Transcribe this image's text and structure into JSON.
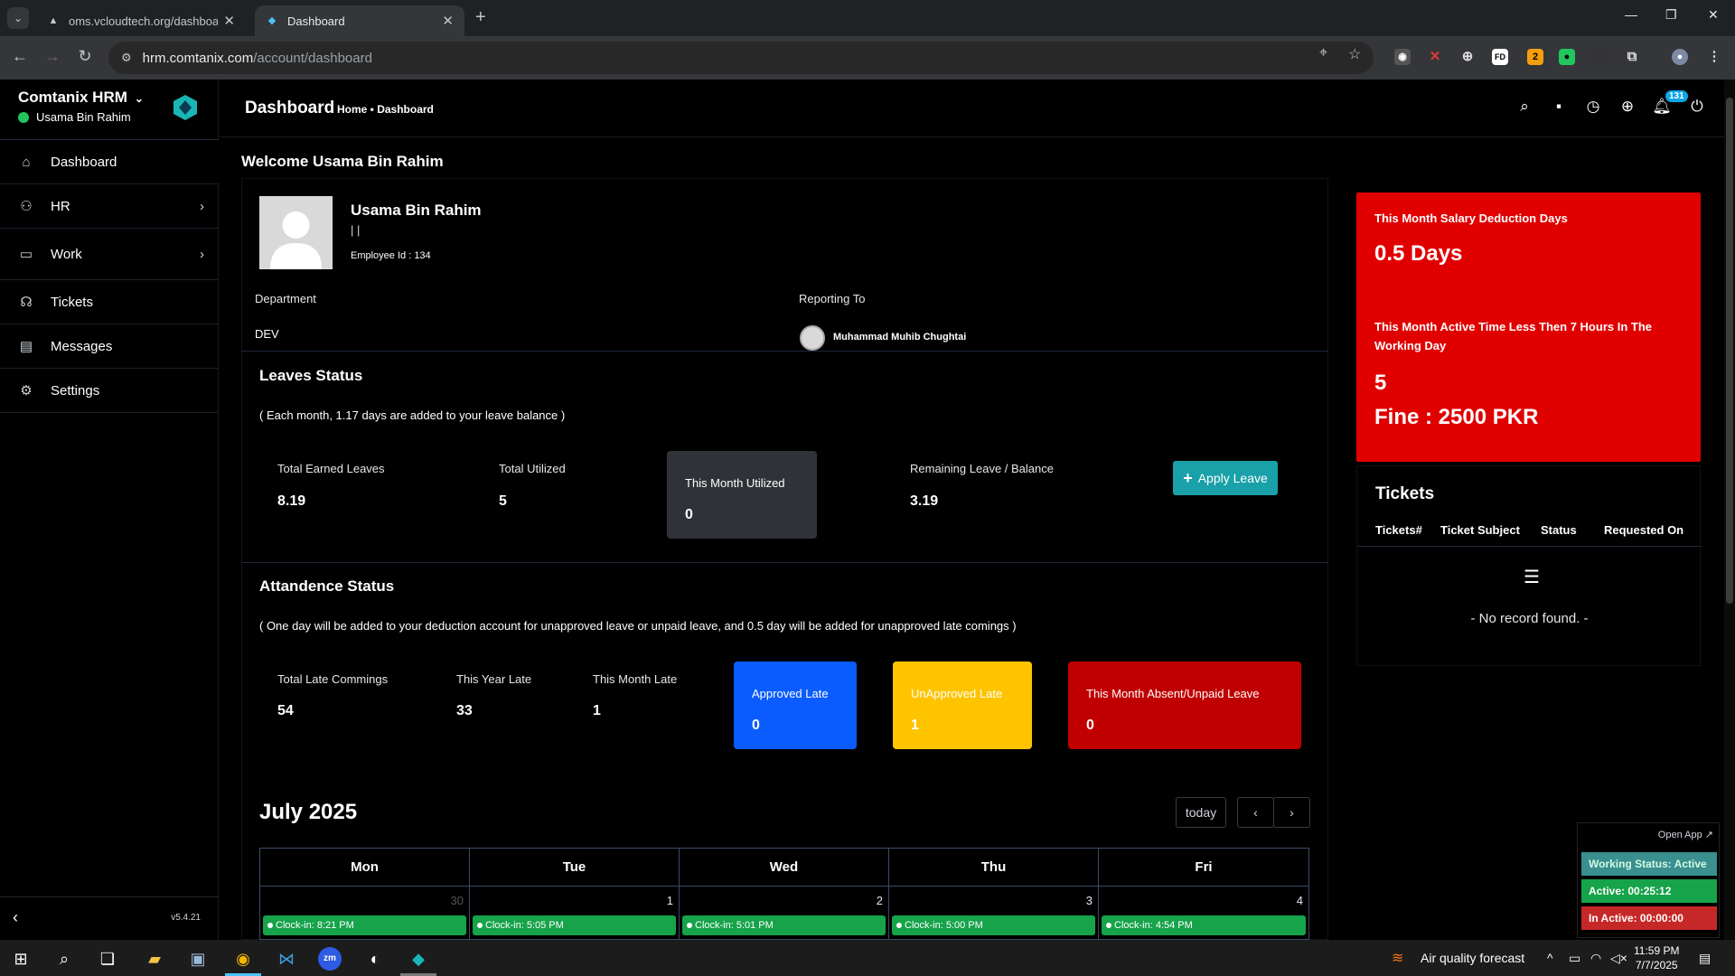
{
  "browser": {
    "tabs": [
      {
        "title": "oms.vcloudtech.org/dashboard",
        "active": false
      },
      {
        "title": "Dashboard",
        "active": true
      }
    ],
    "url_host": "hrm.comtanix.com",
    "url_path": "/account/dashboard"
  },
  "sidebar": {
    "brand": "Comtanix HRM",
    "user": "Usama Bin Rahim",
    "items": [
      {
        "label": "Dashboard",
        "icon": "home-icon"
      },
      {
        "label": "HR",
        "icon": "users-icon"
      },
      {
        "label": "Work",
        "icon": "briefcase-icon"
      },
      {
        "label": "Tickets",
        "icon": "headset-icon"
      },
      {
        "label": "Messages",
        "icon": "message-icon"
      },
      {
        "label": "Settings",
        "icon": "gear-icon"
      }
    ],
    "version": "v5.4.21"
  },
  "header": {
    "title": "Dashboard",
    "breadcrumb": "Home • Dashboard",
    "notification_count": "131"
  },
  "welcome": "Welcome Usama Bin Rahim",
  "profile": {
    "name": "Usama Bin Rahim",
    "designation": "| |",
    "employee_id": "Employee Id : 134",
    "department_label": "Department",
    "department": "DEV",
    "reporting_label": "Reporting To",
    "reporting_to": "Muhammad Muhib Chughtai"
  },
  "leaves": {
    "title": "Leaves Status",
    "note": "( Each month, 1.17 days are added to your leave balance )",
    "total_earned_label": "Total Earned Leaves",
    "total_earned": "8.19",
    "total_utilized_label": "Total Utilized",
    "total_utilized": "5",
    "month_utilized_label": "This Month Utilized",
    "month_utilized": "0",
    "remaining_label": "Remaining Leave / Balance",
    "remaining": "3.19",
    "apply_button": "Apply Leave"
  },
  "attendance": {
    "title": "Attandence Status",
    "note": "( One day will be added to your deduction account for unapproved leave or unpaid leave, and 0.5 day will be added for unapproved late comings )",
    "total_late_label": "Total Late Commings",
    "total_late": "54",
    "year_late_label": "This Year Late",
    "year_late": "33",
    "month_late_label": "This Month Late",
    "month_late": "1",
    "approved_label": "Approved Late",
    "approved": "0",
    "unapproved_label": "UnApproved Late",
    "unapproved": "1",
    "absent_label": "This Month Absent/Unpaid Leave",
    "absent": "0"
  },
  "calendar": {
    "title": "July 2025",
    "today_label": "today",
    "days": [
      {
        "name": "Mon",
        "date": "30",
        "event": "Clock-in: 8:21 PM"
      },
      {
        "name": "Tue",
        "date": "1",
        "event": "Clock-in: 5:05 PM"
      },
      {
        "name": "Wed",
        "date": "2",
        "event": "Clock-in: 5:01 PM"
      },
      {
        "name": "Thu",
        "date": "3",
        "event": "Clock-in: 5:00 PM"
      },
      {
        "name": "Fri",
        "date": "4",
        "event": "Clock-in: 4:54 PM"
      }
    ]
  },
  "deduction": {
    "salary_label": "This Month Salary Deduction Days",
    "salary_value": "0.5 Days",
    "active_label": "This Month Active Time Less Then 7 Hours In The Working Day",
    "active_value": "5",
    "fine": "Fine : 2500 PKR"
  },
  "tickets": {
    "title": "Tickets",
    "columns": [
      "Tickets#",
      "Ticket Subject",
      "Status",
      "Requested On"
    ],
    "empty": "- No record found. -"
  },
  "widget": {
    "open_app": "Open App ↗",
    "working_status": "Working Status: Active",
    "active": "Active: 00:25:12",
    "inactive": "In Active: 00:00:00"
  },
  "taskbar": {
    "weather": "Air quality forecast",
    "time": "11:59 PM",
    "date": "7/7/2025"
  },
  "colors": {
    "approved": "#0a5cff",
    "unapproved": "#ffc400",
    "absent": "#c00000",
    "red_card": "#e00000",
    "apply": "#1aa0a8",
    "event": "#16a34a"
  }
}
